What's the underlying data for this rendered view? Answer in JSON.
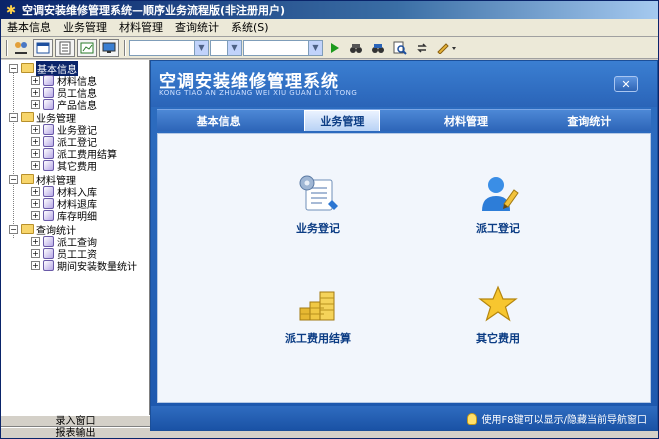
{
  "window": {
    "title": "空调安装维修管理系统—顺序业务流程版(非注册用户)"
  },
  "menu": [
    {
      "label": "基本信息"
    },
    {
      "label": "业务管理"
    },
    {
      "label": "材料管理"
    },
    {
      "label": "查询统计"
    },
    {
      "label": "系统(S)"
    }
  ],
  "toolbar": {
    "icons": [
      "people-scissors-icon",
      "window-icon",
      "document-icon",
      "chart-icon",
      "monitor-icon",
      "play-icon",
      "binoculars-icon",
      "binoculars-find-icon",
      "zoom-page-icon",
      "refresh-icon",
      "pencil-icon"
    ]
  },
  "tree": {
    "groups": [
      {
        "label": "基本信息",
        "items": [
          "材料信息",
          "员工信息",
          "产品信息"
        ]
      },
      {
        "label": "业务管理",
        "items": [
          "业务登记",
          "派工登记",
          "派工费用结算",
          "其它费用"
        ]
      },
      {
        "label": "材料管理",
        "items": [
          "材料入库",
          "材料退库",
          "库存明细"
        ]
      },
      {
        "label": "查询统计",
        "items": [
          "派工查询",
          "员工工资",
          "期间安装数量统计"
        ]
      }
    ]
  },
  "left_footer": {
    "entry_window": "录入窗口",
    "report_output": "报表输出"
  },
  "main": {
    "app_name": "空调安装维修管理系统",
    "app_pinyin": "KONG TIAO AN ZHUANG WEI XIU GUAN LI XI TONG",
    "tabs": [
      {
        "label": "基本信息"
      },
      {
        "label": "业务管理"
      },
      {
        "label": "材料管理"
      },
      {
        "label": "查询统计"
      }
    ],
    "active_tab": "业务管理",
    "nav_items": [
      {
        "label": "业务登记",
        "icon": "document-gear-icon"
      },
      {
        "label": "派工登记",
        "icon": "person-pencil-icon"
      },
      {
        "label": "派工费用结算",
        "icon": "coin-stack-icon"
      },
      {
        "label": "其它费用",
        "icon": "star-icon"
      }
    ],
    "status_hint": "使用F8键可以显示/隐藏当前导航窗口"
  },
  "colors": {
    "title_bar": "#0a246a",
    "panel_blue": "#2a64b8",
    "content_bg": "#f2f6fc",
    "label_blue": "#0b3c84"
  }
}
